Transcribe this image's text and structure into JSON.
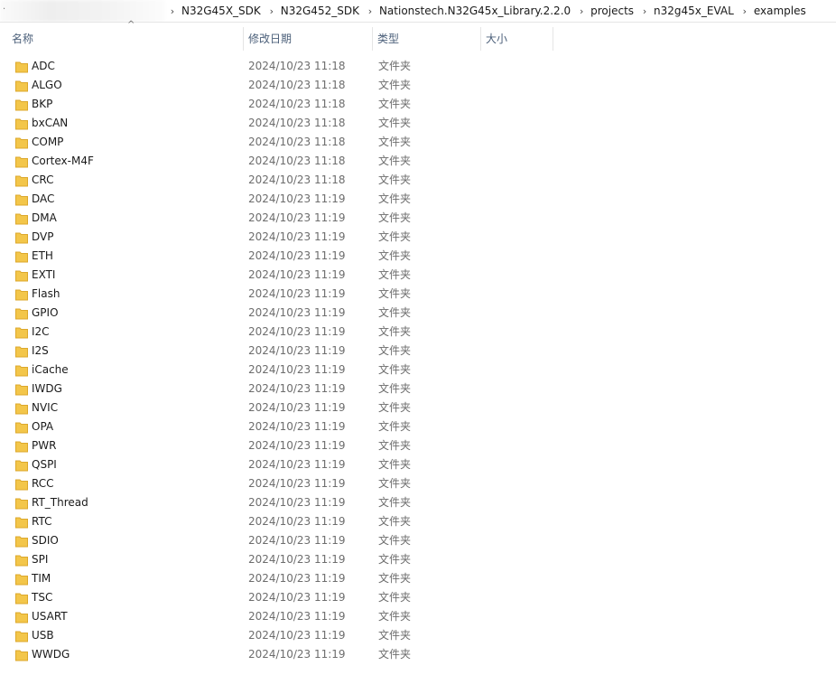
{
  "breadcrumb": {
    "items": [
      "N32G45X_SDK",
      "N32G452_SDK",
      "Nationstech.N32G45x_Library.2.2.0",
      "projects",
      "n32g45x_EVAL",
      "examples"
    ]
  },
  "columns": {
    "name": "名称",
    "date": "修改日期",
    "type": "类型",
    "size": "大小"
  },
  "colors": {
    "folder": "#f3c64a",
    "folder_dark": "#dca82c",
    "header_text": "#4c607a",
    "secondary_text": "#6d6d6d"
  },
  "files": [
    {
      "name": "ADC",
      "date": "2024/10/23 11:18",
      "type": "文件夹",
      "icon": "folder-icon"
    },
    {
      "name": "ALGO",
      "date": "2024/10/23 11:18",
      "type": "文件夹",
      "icon": "folder-icon"
    },
    {
      "name": "BKP",
      "date": "2024/10/23 11:18",
      "type": "文件夹",
      "icon": "folder-icon"
    },
    {
      "name": "bxCAN",
      "date": "2024/10/23 11:18",
      "type": "文件夹",
      "icon": "folder-icon"
    },
    {
      "name": "COMP",
      "date": "2024/10/23 11:18",
      "type": "文件夹",
      "icon": "folder-icon"
    },
    {
      "name": "Cortex-M4F",
      "date": "2024/10/23 11:18",
      "type": "文件夹",
      "icon": "folder-icon"
    },
    {
      "name": "CRC",
      "date": "2024/10/23 11:18",
      "type": "文件夹",
      "icon": "folder-icon"
    },
    {
      "name": "DAC",
      "date": "2024/10/23 11:19",
      "type": "文件夹",
      "icon": "folder-icon"
    },
    {
      "name": "DMA",
      "date": "2024/10/23 11:19",
      "type": "文件夹",
      "icon": "folder-icon"
    },
    {
      "name": "DVP",
      "date": "2024/10/23 11:19",
      "type": "文件夹",
      "icon": "folder-icon"
    },
    {
      "name": "ETH",
      "date": "2024/10/23 11:19",
      "type": "文件夹",
      "icon": "folder-icon"
    },
    {
      "name": "EXTI",
      "date": "2024/10/23 11:19",
      "type": "文件夹",
      "icon": "folder-icon"
    },
    {
      "name": "Flash",
      "date": "2024/10/23 11:19",
      "type": "文件夹",
      "icon": "folder-icon"
    },
    {
      "name": "GPIO",
      "date": "2024/10/23 11:19",
      "type": "文件夹",
      "icon": "folder-icon"
    },
    {
      "name": "I2C",
      "date": "2024/10/23 11:19",
      "type": "文件夹",
      "icon": "folder-icon"
    },
    {
      "name": "I2S",
      "date": "2024/10/23 11:19",
      "type": "文件夹",
      "icon": "folder-icon"
    },
    {
      "name": "iCache",
      "date": "2024/10/23 11:19",
      "type": "文件夹",
      "icon": "folder-icon"
    },
    {
      "name": "IWDG",
      "date": "2024/10/23 11:19",
      "type": "文件夹",
      "icon": "folder-icon"
    },
    {
      "name": "NVIC",
      "date": "2024/10/23 11:19",
      "type": "文件夹",
      "icon": "folder-icon"
    },
    {
      "name": "OPA",
      "date": "2024/10/23 11:19",
      "type": "文件夹",
      "icon": "folder-icon"
    },
    {
      "name": "PWR",
      "date": "2024/10/23 11:19",
      "type": "文件夹",
      "icon": "folder-icon"
    },
    {
      "name": "QSPI",
      "date": "2024/10/23 11:19",
      "type": "文件夹",
      "icon": "folder-icon"
    },
    {
      "name": "RCC",
      "date": "2024/10/23 11:19",
      "type": "文件夹",
      "icon": "folder-icon"
    },
    {
      "name": "RT_Thread",
      "date": "2024/10/23 11:19",
      "type": "文件夹",
      "icon": "folder-icon"
    },
    {
      "name": "RTC",
      "date": "2024/10/23 11:19",
      "type": "文件夹",
      "icon": "folder-icon"
    },
    {
      "name": "SDIO",
      "date": "2024/10/23 11:19",
      "type": "文件夹",
      "icon": "folder-icon"
    },
    {
      "name": "SPI",
      "date": "2024/10/23 11:19",
      "type": "文件夹",
      "icon": "folder-icon"
    },
    {
      "name": "TIM",
      "date": "2024/10/23 11:19",
      "type": "文件夹",
      "icon": "folder-icon"
    },
    {
      "name": "TSC",
      "date": "2024/10/23 11:19",
      "type": "文件夹",
      "icon": "folder-icon"
    },
    {
      "name": "USART",
      "date": "2024/10/23 11:19",
      "type": "文件夹",
      "icon": "folder-icon"
    },
    {
      "name": "USB",
      "date": "2024/10/23 11:19",
      "type": "文件夹",
      "icon": "folder-icon"
    },
    {
      "name": "WWDG",
      "date": "2024/10/23 11:19",
      "type": "文件夹",
      "icon": "folder-icon"
    }
  ]
}
